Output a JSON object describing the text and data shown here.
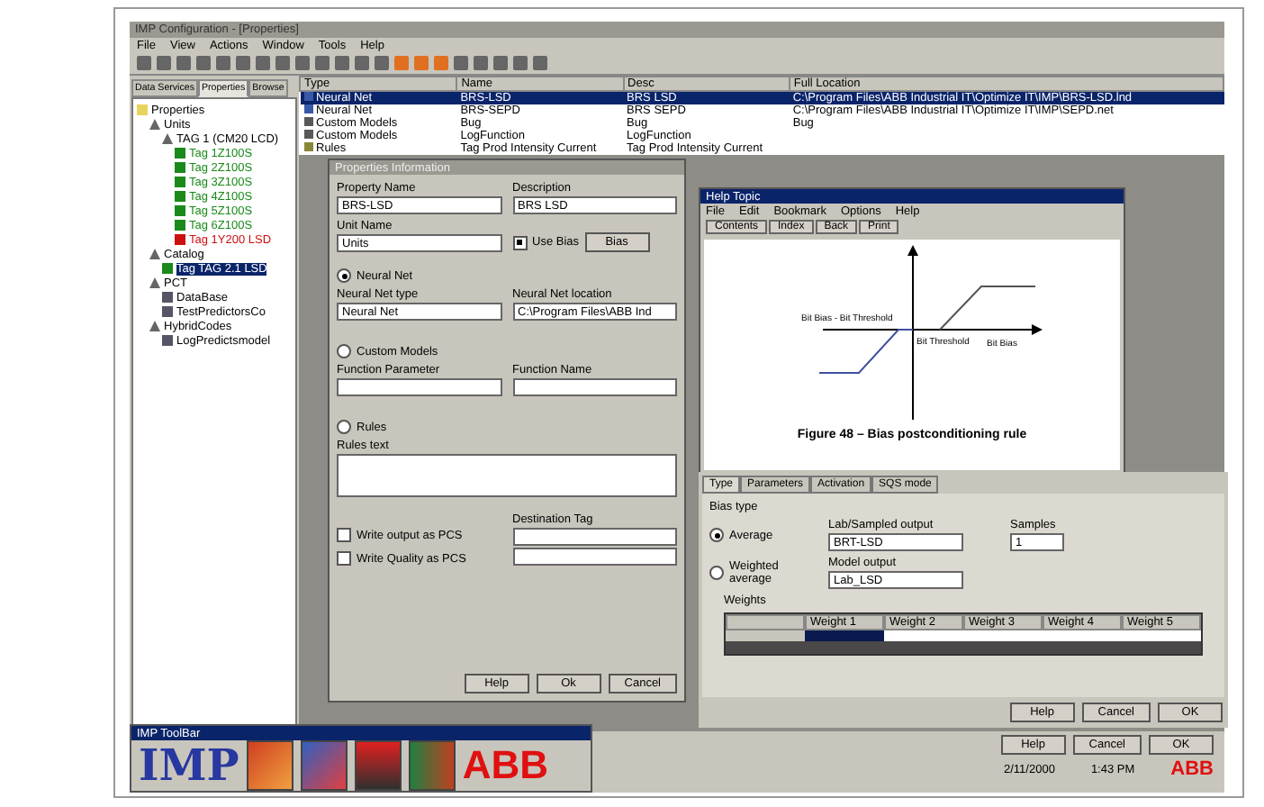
{
  "window": {
    "title": "IMP Configuration - [Properties]"
  },
  "menu": [
    "File",
    "View",
    "Actions",
    "Window",
    "Tools",
    "Help"
  ],
  "left_tabs": [
    {
      "label": "Data Services",
      "selected": false
    },
    {
      "label": "Properties",
      "selected": true
    },
    {
      "label": "Browse",
      "selected": false
    }
  ],
  "tree": [
    {
      "label": "Properties",
      "kind": "folder",
      "selected": false,
      "children": [
        {
          "label": "Units",
          "kind": "unit",
          "selected": false,
          "children": [
            {
              "label": "TAG 1 (CM20 LCD)",
              "kind": "unit",
              "selected": false,
              "children": [
                {
                  "label": "Tag 1Z100S",
                  "kind": "tag",
                  "color": "#1a8a1a",
                  "selected": false
                },
                {
                  "label": "Tag 2Z100S",
                  "kind": "tag",
                  "color": "#1a8a1a",
                  "selected": false
                },
                {
                  "label": "Tag 3Z100S",
                  "kind": "tag",
                  "color": "#1a8a1a",
                  "selected": false
                },
                {
                  "label": "Tag 4Z100S",
                  "kind": "tag",
                  "color": "#1a8a1a",
                  "selected": false
                },
                {
                  "label": "Tag 5Z100S",
                  "kind": "tag",
                  "color": "#1a8a1a",
                  "selected": false
                },
                {
                  "label": "Tag 6Z100S",
                  "kind": "tag",
                  "color": "#1a8a1a",
                  "selected": false
                },
                {
                  "label": "Tag 1Y200 LSD",
                  "kind": "tag",
                  "color": "#cc1010",
                  "selected": false
                }
              ]
            }
          ]
        },
        {
          "label": "Catalog",
          "kind": "unit",
          "selected": false,
          "children": [
            {
              "label": "Tag TAG 2.1 LSD",
              "kind": "tag",
              "color": "#1a8a1a",
              "selected": true
            }
          ]
        },
        {
          "label": "PCT",
          "kind": "unit",
          "selected": false,
          "children": [
            {
              "label": "DataBase",
              "kind": "model",
              "selected": false
            },
            {
              "label": "TestPredictorsCo",
              "kind": "model",
              "selected": false
            }
          ]
        },
        {
          "label": "HybridCodes",
          "kind": "unit",
          "selected": false,
          "children": [
            {
              "label": "LogPredictsmodel",
              "kind": "model",
              "selected": false
            }
          ]
        }
      ]
    }
  ],
  "table": {
    "columns": [
      "Type",
      "Name",
      "Desc",
      "Full Location"
    ],
    "rows": [
      {
        "kind": "net",
        "selected": true,
        "cells": [
          "Neural Net",
          "BRS-LSD",
          "BRS LSD",
          "C:\\Program Files\\ABB Industrial IT\\Optimize IT\\IMP\\BRS-LSD.lnd"
        ]
      },
      {
        "kind": "net",
        "selected": false,
        "cells": [
          "Neural Net",
          "BRS-SEPD",
          "BRS SEPD",
          "C:\\Program Files\\ABB Industrial IT\\Optimize IT\\IMP\\SEPD.net"
        ]
      },
      {
        "kind": "custom",
        "selected": false,
        "cells": [
          "Custom Models",
          "Bug",
          "Bug",
          "Bug"
        ]
      },
      {
        "kind": "custom",
        "selected": false,
        "cells": [
          "Custom Models",
          "LogFunction",
          "LogFunction",
          ""
        ]
      },
      {
        "kind": "rule",
        "selected": false,
        "cells": [
          "Rules",
          "Tag Prod Intensity Current",
          "Tag Prod Intensity Current",
          ""
        ]
      }
    ]
  },
  "dialog": {
    "title": "Properties Information",
    "property_name": {
      "label": "Property Name",
      "value": "BRS-LSD"
    },
    "description": {
      "label": "Description",
      "value": "BRS LSD"
    },
    "unit_name": {
      "label": "Unit Name",
      "value": "Units"
    },
    "use_bias": {
      "label": "Use Bias",
      "checked": true
    },
    "bias_button": "Bias",
    "neural_net": {
      "label": "Neural Net",
      "selected": true
    },
    "net_type": {
      "label": "Neural Net type",
      "value": "Neural Net"
    },
    "net_location": {
      "label": "Neural Net location",
      "value": "C:\\Program Files\\ABB Ind"
    },
    "custom_models": {
      "label": "Custom Models",
      "selected": false
    },
    "function_parameter": {
      "label": "Function Parameter"
    },
    "function_name": {
      "label": "Function Name"
    },
    "rules": {
      "label": "Rules",
      "selected": false
    },
    "rules_text": {
      "label": "Rules text"
    },
    "write_output": {
      "label": "Write output as PCS",
      "checked": false
    },
    "write_quality": {
      "label": "Write Quality as PCS",
      "checked": false
    },
    "destination_tag": {
      "label": "Destination Tag"
    },
    "buttons": [
      "Help",
      "Ok",
      "Cancel"
    ]
  },
  "help_window": {
    "title": "Help Topic",
    "menu": [
      "File",
      "Edit",
      "Bookmark",
      "Options",
      "Help"
    ],
    "buttons": [
      "Contents",
      "Index",
      "Back",
      "Print"
    ],
    "labels": [
      "Bit Bias - Bit Threshold",
      "Bit Threshold",
      "Bit Bias"
    ],
    "caption": "Figure 48 – Bias postconditioning rule"
  },
  "bias_panel": {
    "tabs": [
      {
        "label": "Type",
        "selected": true
      },
      {
        "label": "Parameters",
        "selected": false
      },
      {
        "label": "Activation",
        "selected": false
      },
      {
        "label": "SQS mode",
        "selected": false
      }
    ],
    "group": "Bias type",
    "options": [
      {
        "label": "Average",
        "selected": true
      },
      {
        "label": "Weighted average",
        "selected": false
      }
    ],
    "lab_output": {
      "label": "Lab/Sampled output",
      "value": "BRT-LSD"
    },
    "model_output": {
      "label": "Model output",
      "value": "Lab_LSD"
    },
    "samples": {
      "label": "Samples",
      "value": "1"
    },
    "weights_label": "Weights",
    "weights": [
      "Weight 1",
      "Weight 2",
      "Weight 3",
      "Weight 4",
      "Weight 5"
    ],
    "buttons": [
      "Help",
      "Cancel",
      "OK"
    ]
  },
  "buttons": [
    "Help",
    "Cancel",
    "OK"
  ],
  "status_bar": {
    "date": "2/11/2000",
    "time": "1:43 PM",
    "logo": "ABB"
  },
  "toolbar_window": {
    "title": "IMP ToolBar",
    "logo": "IMP",
    "brand": "ABB"
  }
}
